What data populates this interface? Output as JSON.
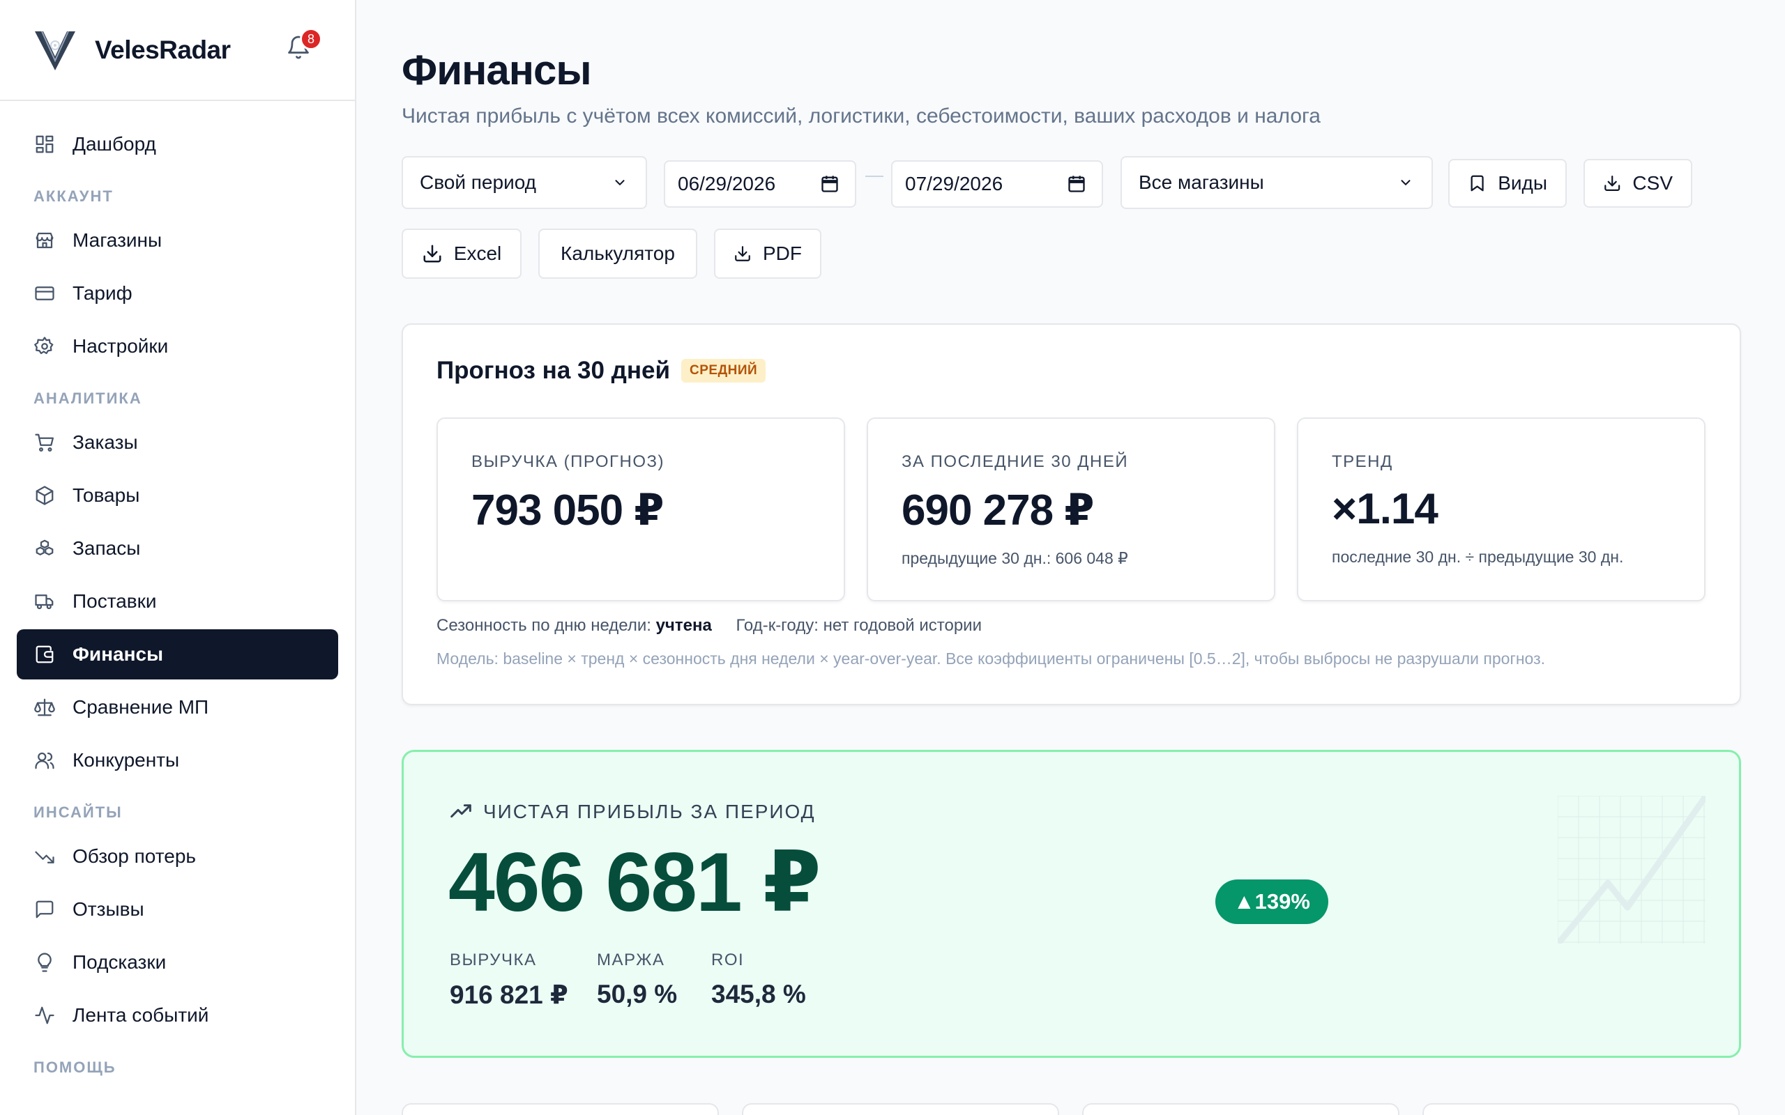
{
  "brand": {
    "name": "VelesRadar",
    "notifications": "8"
  },
  "sidebar": {
    "dashboard": "Дашборд",
    "sections": {
      "account": "АККАУНТ",
      "analytics": "АНАЛИТИКА",
      "insights": "ИНСАЙТЫ",
      "help": "ПОМОЩЬ"
    },
    "account_items": [
      "Магазины",
      "Тариф",
      "Настройки"
    ],
    "analytics_items": [
      "Заказы",
      "Товары",
      "Запасы",
      "Поставки",
      "Финансы",
      "Сравнение МП",
      "Конкуренты"
    ],
    "insights_items": [
      "Обзор потерь",
      "Отзывы",
      "Подсказки",
      "Лента событий"
    ]
  },
  "page": {
    "title": "Финансы",
    "subtitle": "Чистая прибыль с учётом всех комиссий, логистики, себестоимости, ваших расходов и налога"
  },
  "filters": {
    "period": "Свой период",
    "date_from": "06/29/2026",
    "date_to": "07/29/2026",
    "stores": "Все магазины",
    "views": "Виды",
    "csv": "CSV",
    "excel": "Excel",
    "calculator": "Калькулятор",
    "pdf": "PDF"
  },
  "forecast": {
    "title": "Прогноз на 30 дней",
    "badge": "СРЕДНИЙ",
    "kpis": [
      {
        "label": "ВЫРУЧКА (ПРОГНОЗ)",
        "value": "793 050 ₽",
        "sub": ""
      },
      {
        "label": "ЗА ПОСЛЕДНИЕ 30 ДНЕЙ",
        "value": "690 278 ₽",
        "sub": "предыдущие 30 дн.: 606 048 ₽"
      },
      {
        "label": "ТРЕНД",
        "value": "×1.14",
        "sub": "последние 30 дн. ÷ предыдущие 30 дн."
      }
    ],
    "seasonality_label": "Сезонность по дню недели:",
    "seasonality_value": "учтена",
    "yoy": "Год-к-году: нет годовой истории",
    "model_note": "Модель: baseline × тренд × сезонность дня недели × year-over-year. Все коэффициенты ограничены [0.5…2], чтобы выбросы не разрушали прогноз."
  },
  "profit": {
    "title": "ЧИСТАЯ ПРИБЫЛЬ ЗА ПЕРИОД",
    "value": "466 681 ₽",
    "delta": "▲139%",
    "metrics": [
      {
        "label": "ВЫРУЧКА",
        "value": "916 821 ₽"
      },
      {
        "label": "МАРЖА",
        "value": "50,9 %"
      },
      {
        "label": "ROI",
        "value": "345,8 %"
      }
    ]
  }
}
